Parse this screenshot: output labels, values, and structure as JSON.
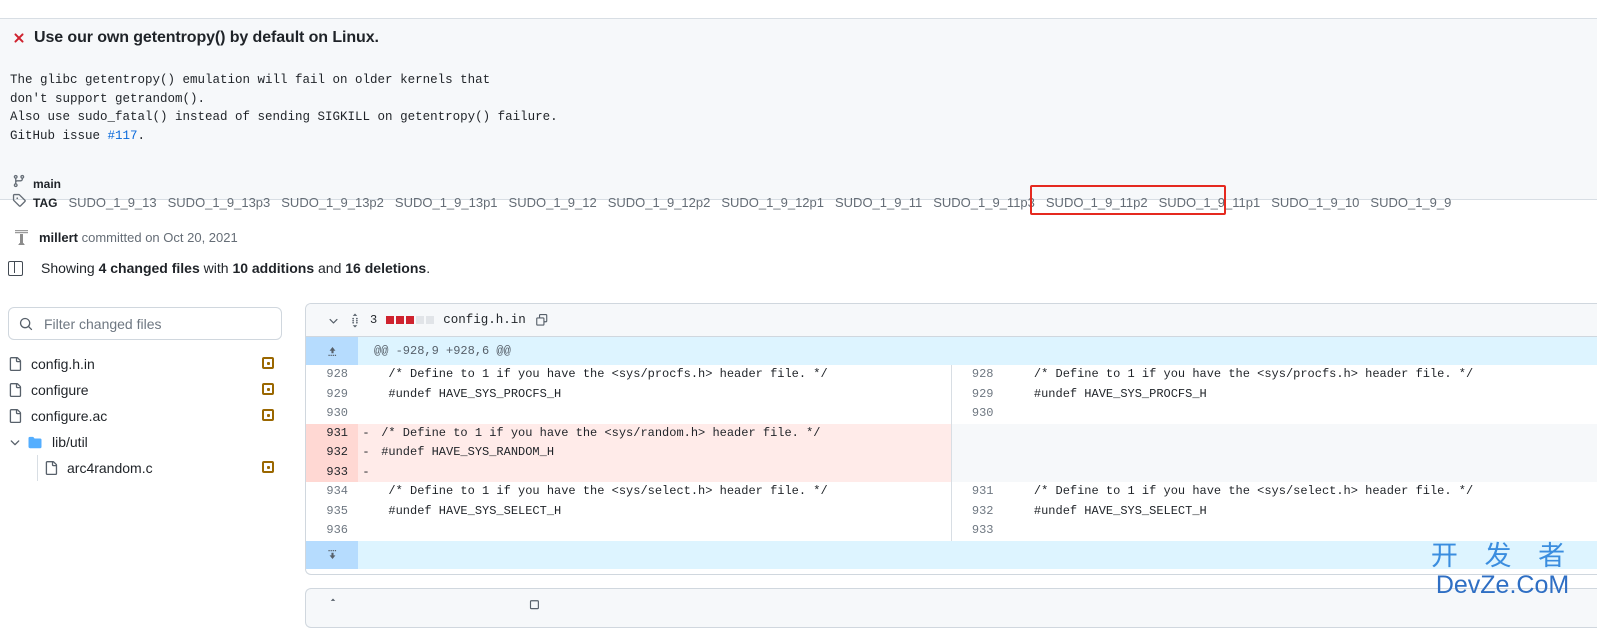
{
  "commit": {
    "status_icon": "x-icon",
    "title": "Use our own getentropy() by default on Linux.",
    "description_line1": "The glibc getentropy() emulation will fail on older kernels that",
    "description_line2": "don't support getrandom().",
    "description_line3": "Also use sudo_fatal() instead of sending SIGKILL on getentropy() failure.",
    "description_line4_prefix": "GitHub issue ",
    "issue_link": "#117",
    "description_line4_suffix": ".",
    "branch_icon": "git-branch-icon",
    "branch": "main",
    "tag_icon": "tag-icon",
    "tag_label": "TAG",
    "tags": [
      "SUDO_1_9_13",
      "SUDO_1_9_13p3",
      "SUDO_1_9_13p2",
      "SUDO_1_9_13p1",
      "SUDO_1_9_12",
      "SUDO_1_9_12p2",
      "SUDO_1_9_12p1",
      "SUDO_1_9_11",
      "SUDO_1_9_11p3",
      "SUDO_1_9_11p2",
      "SUDO_1_9_11p1",
      "SUDO_1_9_10",
      "SUDO_1_9_9"
    ],
    "highlight_color": "#e5291f",
    "author": "millert",
    "committed_text": " committed on Oct 20, 2021"
  },
  "summary": {
    "toggle_icon": "sidebar-toggle-icon",
    "prefix": "Showing ",
    "files_count": "4 changed files",
    "middle": " with ",
    "additions": "10 additions",
    "conj": " and ",
    "deletions": "16 deletions",
    "suffix": "."
  },
  "filetree": {
    "search_icon": "search-icon",
    "filter_placeholder": "Filter changed files",
    "filter_value": "",
    "items": [
      {
        "name": "config.h.in",
        "type": "file",
        "indent": 0,
        "status": "modified"
      },
      {
        "name": "configure",
        "type": "file",
        "indent": 0,
        "status": "modified"
      },
      {
        "name": "configure.ac",
        "type": "file",
        "indent": 0,
        "status": "modified"
      },
      {
        "name": "lib/util",
        "type": "folder",
        "indent": 0,
        "status": ""
      },
      {
        "name": "arc4random.c",
        "type": "file",
        "indent": 1,
        "status": "modified"
      }
    ]
  },
  "diff": {
    "collapse_icon": "chevron-down-icon",
    "drag_icon": "drag-handle-icon",
    "stat_count": "3",
    "stat_deleted_blocks": 3,
    "stat_neutral_blocks": 2,
    "filename": "config.h.in",
    "copy_icon": "copy-icon",
    "hunk_header": "@@ -928,9 +928,6 @@",
    "expand_up_icon": "expand-up-icon",
    "expand_down_icon": "expand-down-icon",
    "rows": [
      {
        "kind": "ctx",
        "left_num": "928",
        "left_sign": "",
        "left_code": "  /* Define to 1 if you have the <sys/procfs.h> header file. */",
        "right_num": "928",
        "right_sign": "",
        "right_code": "  /* Define to 1 if you have the <sys/procfs.h> header file. */"
      },
      {
        "kind": "ctx",
        "left_num": "929",
        "left_sign": "",
        "left_code": "  #undef HAVE_SYS_PROCFS_H",
        "right_num": "929",
        "right_sign": "",
        "right_code": "  #undef HAVE_SYS_PROCFS_H"
      },
      {
        "kind": "ctx",
        "left_num": "930",
        "left_sign": "",
        "left_code": "",
        "right_num": "930",
        "right_sign": "",
        "right_code": ""
      },
      {
        "kind": "del",
        "left_num": "931",
        "left_sign": "-",
        "left_code": " /* Define to 1 if you have the <sys/random.h> header file. */",
        "right_num": "",
        "right_sign": "",
        "right_code": ""
      },
      {
        "kind": "del",
        "left_num": "932",
        "left_sign": "-",
        "left_code": " #undef HAVE_SYS_RANDOM_H",
        "right_num": "",
        "right_sign": "",
        "right_code": ""
      },
      {
        "kind": "del",
        "left_num": "933",
        "left_sign": "-",
        "left_code": "",
        "right_num": "",
        "right_sign": "",
        "right_code": ""
      },
      {
        "kind": "ctx",
        "left_num": "934",
        "left_sign": "",
        "left_code": "  /* Define to 1 if you have the <sys/select.h> header file. */",
        "right_num": "931",
        "right_sign": "",
        "right_code": "  /* Define to 1 if you have the <sys/select.h> header file. */"
      },
      {
        "kind": "ctx",
        "left_num": "935",
        "left_sign": "",
        "left_code": "  #undef HAVE_SYS_SELECT_H",
        "right_num": "932",
        "right_sign": "",
        "right_code": "  #undef HAVE_SYS_SELECT_H"
      },
      {
        "kind": "ctx",
        "left_num": "936",
        "left_sign": "",
        "left_code": "",
        "right_num": "933",
        "right_sign": "",
        "right_code": ""
      }
    ]
  },
  "watermark": {
    "line1": "开 发 者",
    "line2": "DevZe.CoM"
  }
}
